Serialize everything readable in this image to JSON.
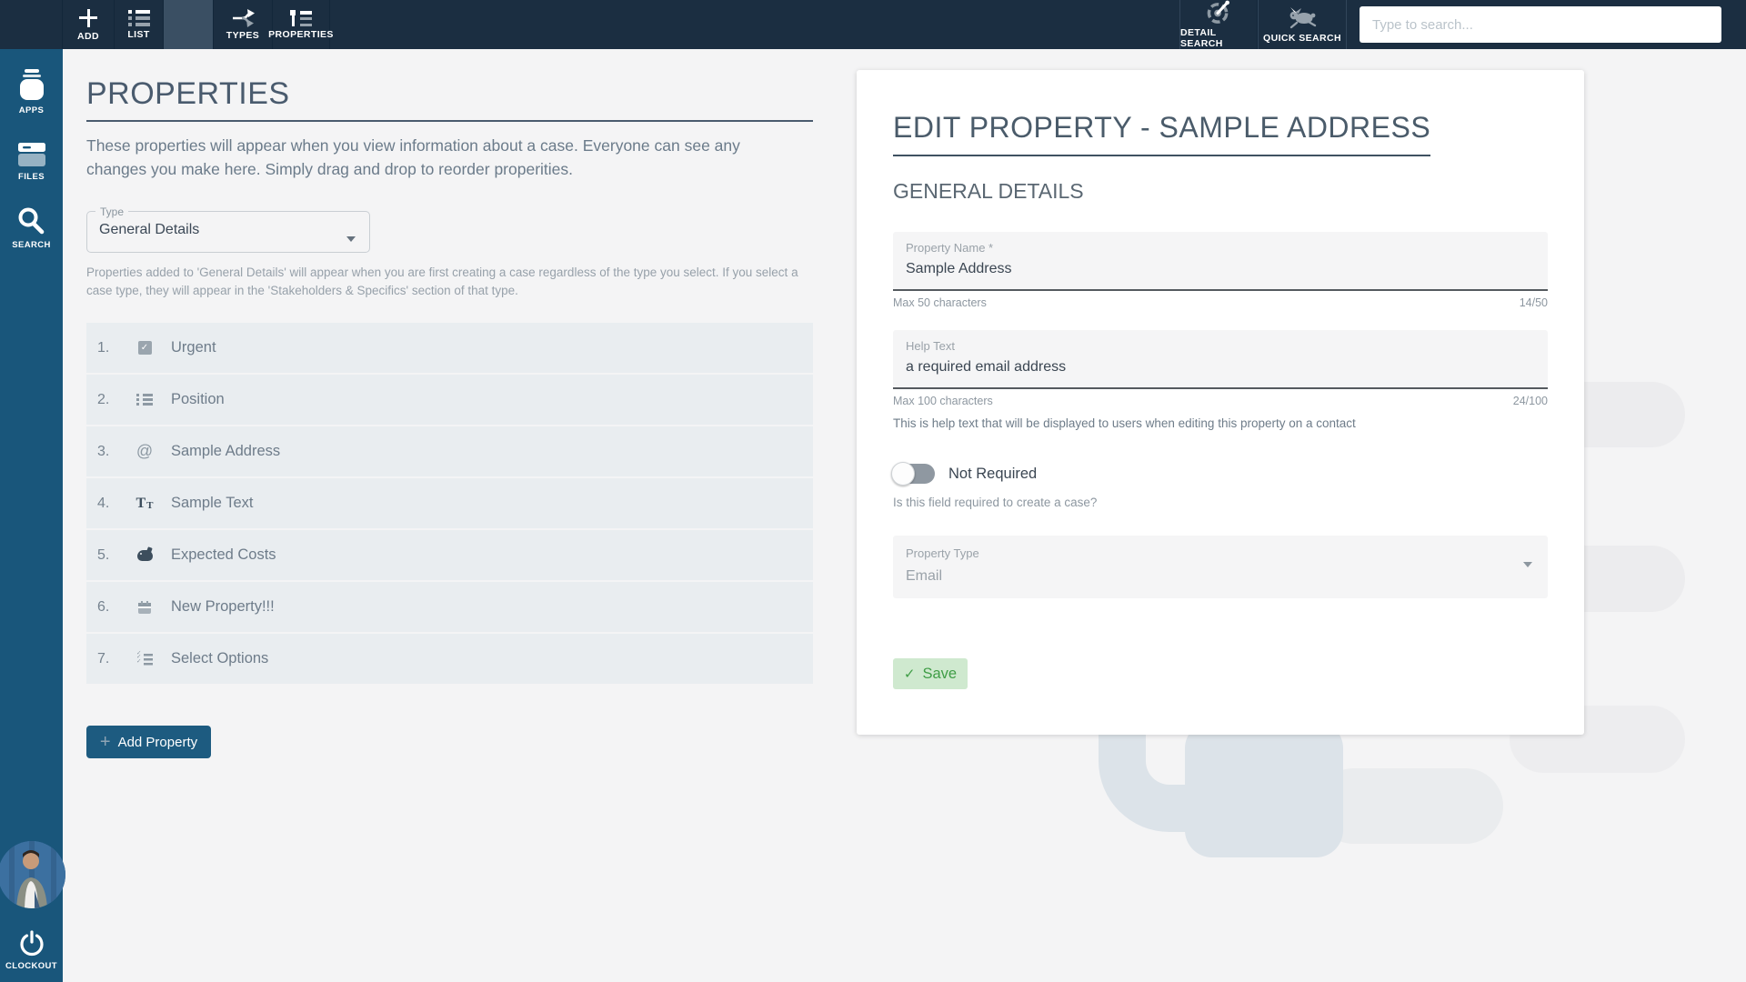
{
  "topbar": {
    "tabs": [
      {
        "label": "ADD",
        "icon": "plus-icon"
      },
      {
        "label": "LIST",
        "icon": "list-icon"
      },
      {
        "label": "TYPES",
        "icon": "branch-arrows-icon"
      },
      {
        "label": "PROPERTIES",
        "icon": "tree-list-icon"
      }
    ],
    "right_tabs": [
      {
        "label": "DETAIL SEARCH",
        "icon": "gauge-icon"
      },
      {
        "label": "QUICK SEARCH",
        "icon": "rabbit-icon"
      }
    ],
    "search_placeholder": "Type to search..."
  },
  "sidebar": {
    "items": [
      {
        "label": "APPS",
        "icon": "jar-icon"
      },
      {
        "label": "FILES",
        "icon": "drawer-icon"
      },
      {
        "label": "SEARCH",
        "icon": "magnifier-icon"
      }
    ],
    "clockout_label": "CLOCKOUT"
  },
  "left_panel": {
    "title": "PROPERTIES",
    "description": "These properties will appear when you view information about a case. Everyone can see any changes you make here. Simply drag and drop to reorder properities.",
    "type_label": "Type",
    "type_value": "General Details",
    "helper": "Properties added to 'General Details' will appear when you are first creating a case regardless of the type you select. If you select a case type, they will appear in the 'Stakeholders & Specifics' section of that type.",
    "properties": [
      {
        "num": "1.",
        "icon": "checkbox-checked",
        "label": "Urgent"
      },
      {
        "num": "2.",
        "icon": "list-bullets",
        "label": "Position"
      },
      {
        "num": "3.",
        "icon": "at-sign",
        "label": "Sample Address"
      },
      {
        "num": "4.",
        "icon": "text-format",
        "label": "Sample Text"
      },
      {
        "num": "5.",
        "icon": "piggy-bank",
        "label": "Expected Costs"
      },
      {
        "num": "6.",
        "icon": "calendar",
        "label": "New Property!!!"
      },
      {
        "num": "7.",
        "icon": "checklist",
        "label": "Select Options"
      }
    ],
    "add_button": "Add Property"
  },
  "edit_panel": {
    "title": "EDIT PROPERTY - SAMPLE ADDRESS",
    "section": "GENERAL DETAILS",
    "property_name": {
      "label": "Property Name *",
      "value": "Sample Address",
      "hint": "Max 50 characters",
      "counter": "14/50"
    },
    "help_text": {
      "label": "Help Text",
      "value": "a required email address",
      "hint": "Max 100 characters",
      "counter": "24/100",
      "description": "This is help text that will be displayed to users when editing this property on a contact"
    },
    "toggle": {
      "label": "Not Required",
      "state": "off",
      "description": "Is this field required to create a case?"
    },
    "property_type": {
      "label": "Property Type",
      "value": "Email"
    },
    "save_button": "Save"
  },
  "colors": {
    "topbar_bg": "#1b2e41",
    "sidebar_bg": "#19567b",
    "accent_button": "#1d5b80",
    "row_bg": "#e9edf0",
    "save_bg": "#cfe9cf",
    "save_text": "#3f9d46"
  }
}
